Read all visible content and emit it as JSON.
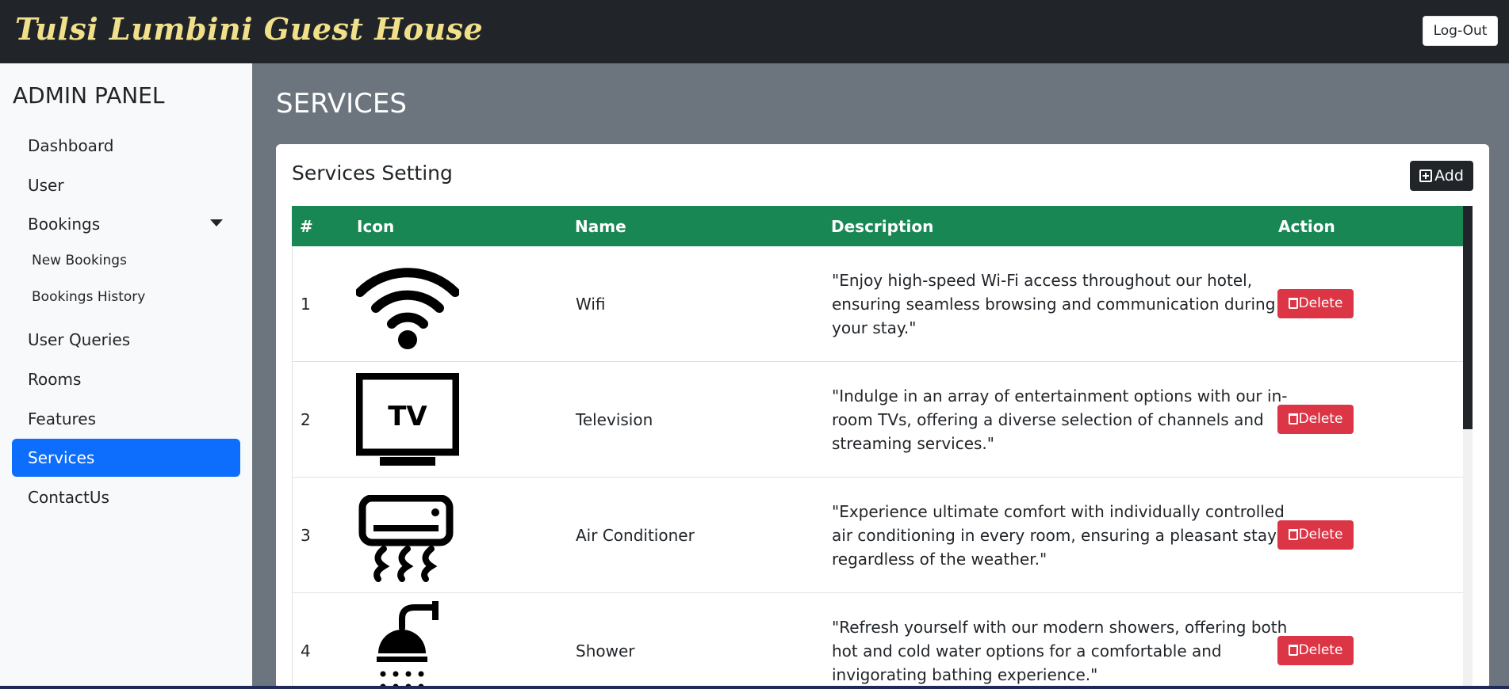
{
  "header": {
    "brand": "Tulsi Lumbini Guest House",
    "logout_label": "Log-Out"
  },
  "sidebar": {
    "title": "ADMIN PANEL",
    "items": [
      {
        "label": "Dashboard"
      },
      {
        "label": "User"
      },
      {
        "label": "Bookings"
      },
      {
        "label": "New Bookings"
      },
      {
        "label": "Bookings History"
      },
      {
        "label": "User Queries"
      },
      {
        "label": "Rooms"
      },
      {
        "label": "Features"
      },
      {
        "label": "Services",
        "active": true
      },
      {
        "label": "ContactUs"
      }
    ]
  },
  "page": {
    "title": "SERVICES"
  },
  "card": {
    "title": "Services Setting",
    "add_label": "Add"
  },
  "table": {
    "headers": [
      "#",
      "Icon",
      "Name",
      "Description",
      "Action"
    ],
    "delete_label": "Delete",
    "rows": [
      {
        "num": "1",
        "icon": "wifi-icon",
        "name": "Wifi",
        "description": "\"Enjoy high-speed Wi-Fi access throughout our hotel, ensuring seamless browsing and communication during your stay.\""
      },
      {
        "num": "2",
        "icon": "tv-icon",
        "name": "Television",
        "description": "\"Indulge in an array of entertainment options with our in-room TVs, offering a diverse selection of channels and streaming services.\""
      },
      {
        "num": "3",
        "icon": "air-conditioner-icon",
        "name": "Air Conditioner",
        "description": "\"Experience ultimate comfort with individually controlled air conditioning in every room, ensuring a pleasant stay regardless of the weather.\""
      },
      {
        "num": "4",
        "icon": "shower-icon",
        "name": "Shower",
        "description": "\"Refresh yourself with our modern showers, offering both hot and cold water options for a comfortable and invigorating bathing experience.\""
      }
    ],
    "tv_icon_text": "TV"
  },
  "colors": {
    "topbar": "#212529",
    "brand": "#f1e08a",
    "active_nav": "#0d6efd",
    "table_header": "#198754",
    "delete": "#dc3545",
    "content_bg": "#6c757d"
  }
}
